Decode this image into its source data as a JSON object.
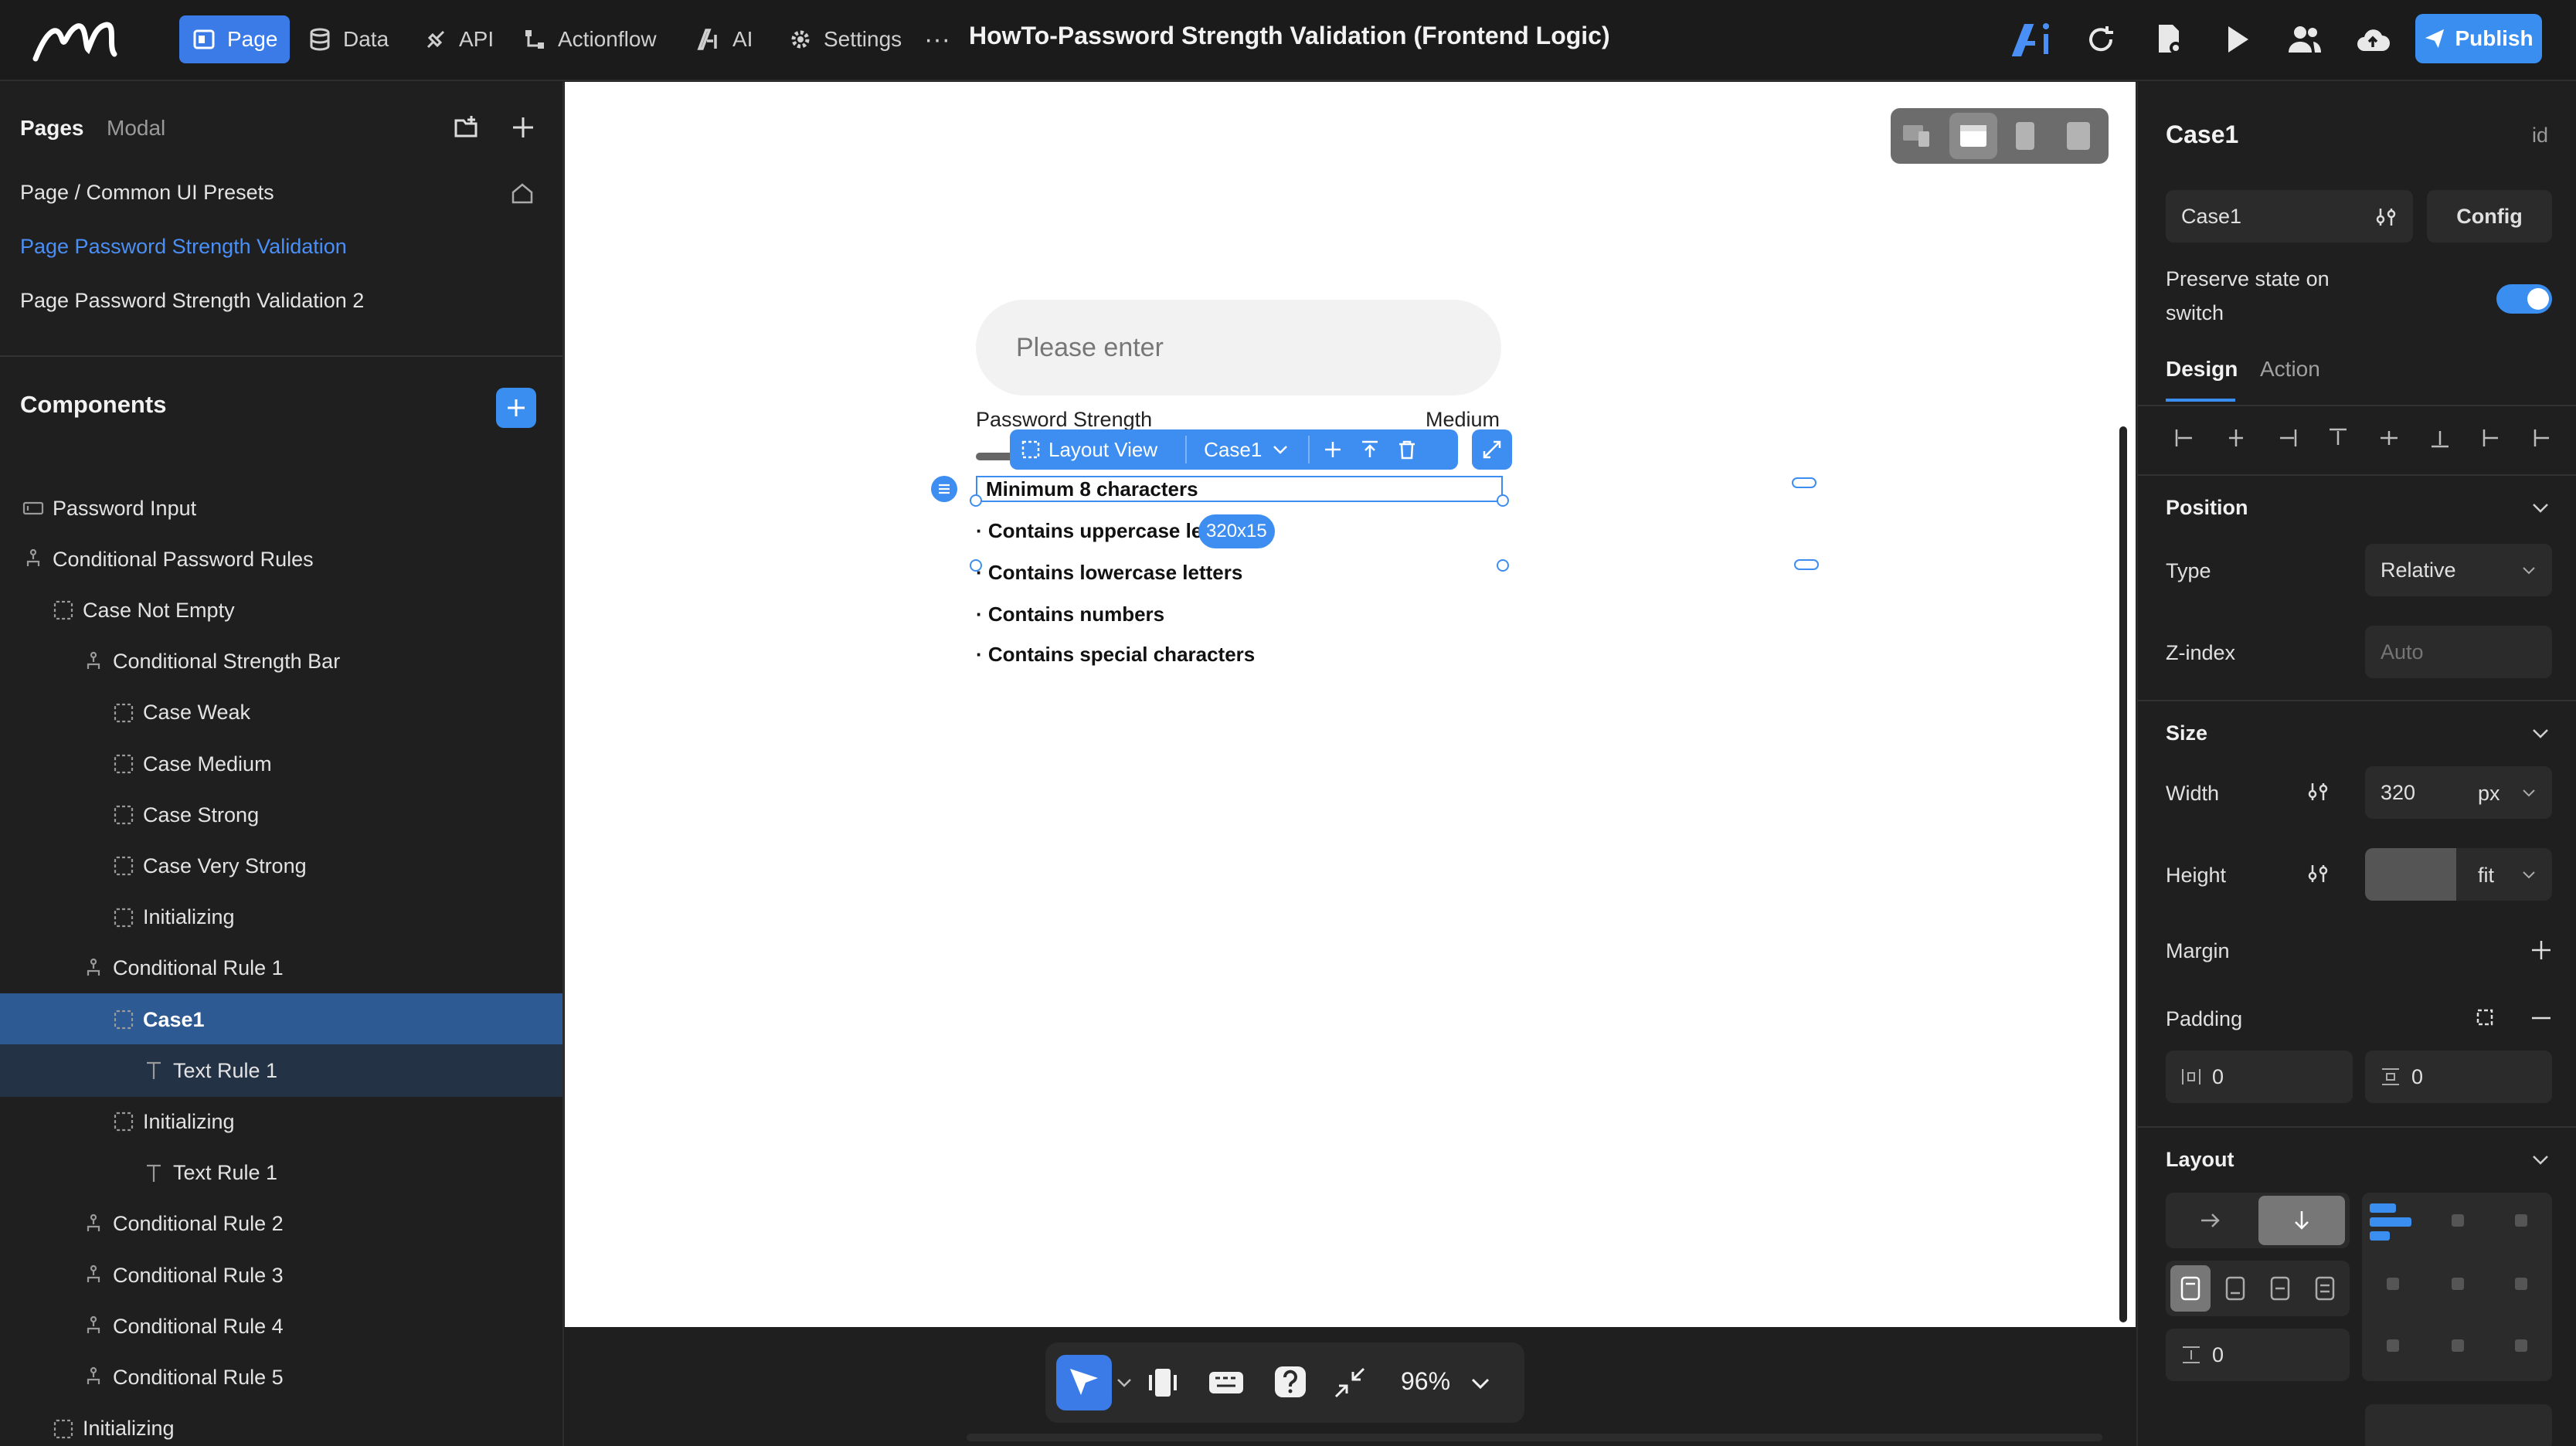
{
  "topbar": {
    "nav": [
      {
        "label": "Page",
        "icon": "page-icon",
        "active": true
      },
      {
        "label": "Data",
        "icon": "database-icon"
      },
      {
        "label": "API",
        "icon": "api-icon"
      },
      {
        "label": "Actionflow",
        "icon": "flow-icon"
      },
      {
        "label": "AI",
        "icon": "ai-icon"
      },
      {
        "label": "Settings",
        "icon": "gear-icon"
      }
    ],
    "more": "···",
    "title": "HowTo-Password Strength Validation (Frontend Logic)",
    "publish_label": "Publish",
    "accent": "#3a8ef0"
  },
  "left": {
    "tabs": [
      "Pages",
      "Modal"
    ],
    "pages": [
      "Page / Common UI Presets",
      "Page Password Strength Validation",
      "Page Password Strength Validation 2"
    ],
    "components_title": "Components",
    "tree": [
      {
        "label": "Password Input",
        "depth": 1,
        "icon": "input-icon"
      },
      {
        "label": "Conditional Password Rules",
        "depth": 1,
        "icon": "branch-icon"
      },
      {
        "label": "Case Not Empty",
        "depth": 2,
        "icon": "case-icon"
      },
      {
        "label": "Conditional Strength Bar",
        "depth": 3,
        "icon": "branch-icon"
      },
      {
        "label": "Case Weak",
        "depth": 4,
        "icon": "case-icon"
      },
      {
        "label": "Case Medium",
        "depth": 4,
        "icon": "case-icon"
      },
      {
        "label": "Case Strong",
        "depth": 4,
        "icon": "case-icon"
      },
      {
        "label": "Case Very Strong",
        "depth": 4,
        "icon": "case-icon"
      },
      {
        "label": "Initializing",
        "depth": 4,
        "icon": "case-icon"
      },
      {
        "label": "Conditional Rule 1",
        "depth": 3,
        "icon": "branch-icon"
      },
      {
        "label": "Case1",
        "depth": 4,
        "icon": "case-icon",
        "selected": true
      },
      {
        "label": "Text Rule 1",
        "depth": 5,
        "icon": "text-icon",
        "child_selected": true
      },
      {
        "label": "Initializing",
        "depth": 4,
        "icon": "case-icon"
      },
      {
        "label": "Text Rule 1",
        "depth": 5,
        "icon": "text-icon"
      },
      {
        "label": "Conditional Rule 2",
        "depth": 3,
        "icon": "branch-icon"
      },
      {
        "label": "Conditional Rule 3",
        "depth": 3,
        "icon": "branch-icon"
      },
      {
        "label": "Conditional Rule 4",
        "depth": 3,
        "icon": "branch-icon"
      },
      {
        "label": "Conditional Rule 5",
        "depth": 3,
        "icon": "branch-icon"
      },
      {
        "label": "Initializing",
        "depth": 2,
        "icon": "case-icon"
      }
    ]
  },
  "canvas": {
    "input_placeholder": "Please enter",
    "strength_label": "Password Strength",
    "strength_value": "Medium",
    "toolbar_label": "Layout View",
    "toolbar_case": "Case1",
    "size_badge": "320x15",
    "rules": [
      "Minimum 8 characters",
      "· Contains uppercase le",
      "· Contains lowercase letters",
      "· Contains numbers",
      "· Contains special characters"
    ]
  },
  "bottom": {
    "zoom": "96%"
  },
  "right": {
    "title": "Case1",
    "id_label": "id",
    "case_select": "Case1",
    "config_label": "Config",
    "preserve_label_1": "Preserve state on",
    "preserve_label_2": "switch",
    "tabs": [
      "Design",
      "Action"
    ],
    "position": {
      "title": "Position",
      "type_label": "Type",
      "type_value": "Relative",
      "z_label": "Z-index",
      "z_placeholder": "Auto"
    },
    "size": {
      "title": "Size",
      "width_label": "Width",
      "width_value": "320",
      "width_unit": "px",
      "height_label": "Height",
      "height_unit": "fit",
      "margin_label": "Margin",
      "padding_label": "Padding",
      "pad_h": "0",
      "pad_v": "0"
    },
    "layout": {
      "title": "Layout",
      "gap": "0"
    }
  }
}
